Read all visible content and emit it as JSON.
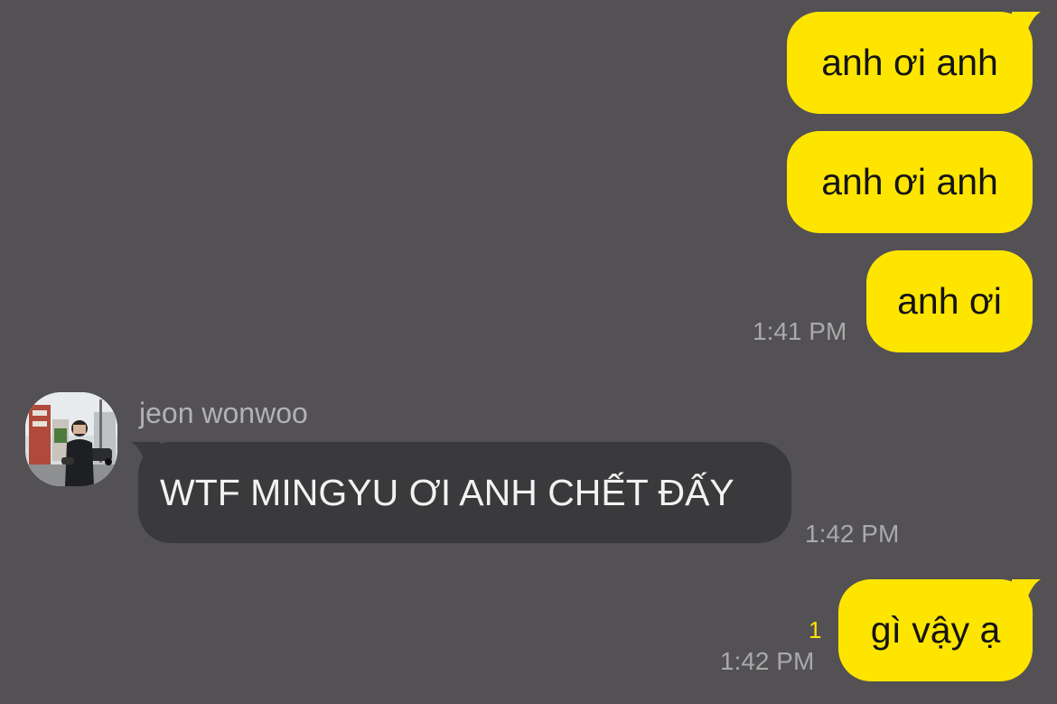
{
  "chat": {
    "messages": [
      {
        "direction": "outgoing",
        "text": "anh ơi anh"
      },
      {
        "direction": "outgoing",
        "text": "anh ơi anh"
      },
      {
        "direction": "outgoing",
        "text": "anh ơi",
        "time": "1:41 PM"
      },
      {
        "direction": "incoming",
        "sender": "jeon wonwoo",
        "text": "WTF MINGYU ƠI ANH CHẾT ĐẤY",
        "time": "1:42 PM"
      },
      {
        "direction": "outgoing",
        "text": "gì vậy ạ",
        "unread_count": "1",
        "time": "1:42 PM"
      }
    ]
  },
  "colors": {
    "background": "#535153",
    "outgoing_bubble": "#FEE500",
    "incoming_bubble": "#3A393B",
    "timestamp": "#A9A8AA",
    "unread_count": "#FEE500"
  },
  "icons": {
    "avatar": "profile-photo-avatar",
    "bubble_tail": "speech-bubble-tail"
  }
}
